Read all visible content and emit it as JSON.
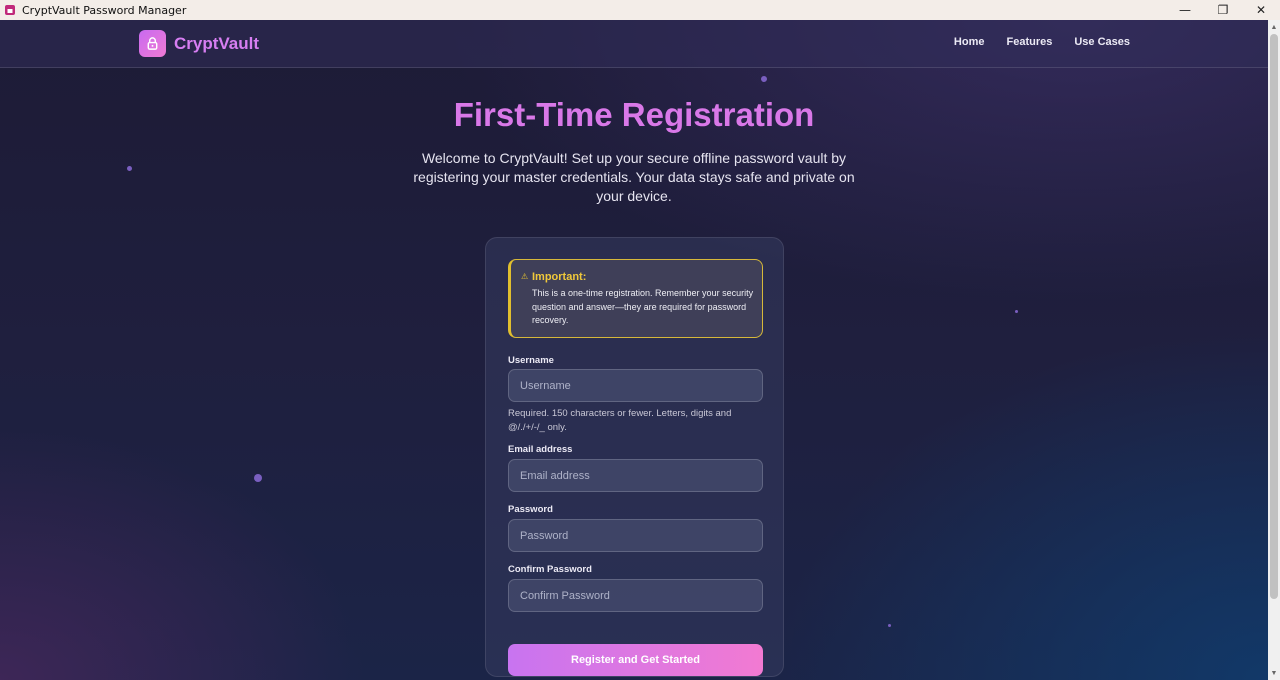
{
  "window": {
    "title": "CryptVault Password Manager",
    "controls": {
      "minimize": "—",
      "restore": "❐",
      "close": "✕"
    }
  },
  "nav": {
    "brand": "CryptVault",
    "brand_icon": "lock-icon",
    "links": [
      "Home",
      "Features",
      "Use Cases"
    ]
  },
  "hero": {
    "title": "First-Time Registration",
    "subtitle": "Welcome to CryptVault! Set up your secure offline password vault by registering your master credentials. Your data stays safe and private on your device."
  },
  "notice": {
    "icon": "warning-icon",
    "title": "Important:",
    "body": "This is a one-time registration. Remember your security question and answer—they are required for password recovery."
  },
  "form": {
    "username": {
      "label": "Username",
      "placeholder": "Username",
      "help": "Required. 150 characters or fewer. Letters, digits and @/./+/-/_ only."
    },
    "email": {
      "label": "Email address",
      "placeholder": "Email address"
    },
    "password": {
      "label": "Password",
      "placeholder": "Password"
    },
    "confirm_password": {
      "label": "Confirm Password",
      "placeholder": "Confirm Password"
    },
    "submit_label": "Register and Get Started"
  },
  "colors": {
    "accent": "#d978e8",
    "button_start": "#c874f0",
    "button_end": "#f27ad2",
    "warning": "#e1bf2e"
  }
}
